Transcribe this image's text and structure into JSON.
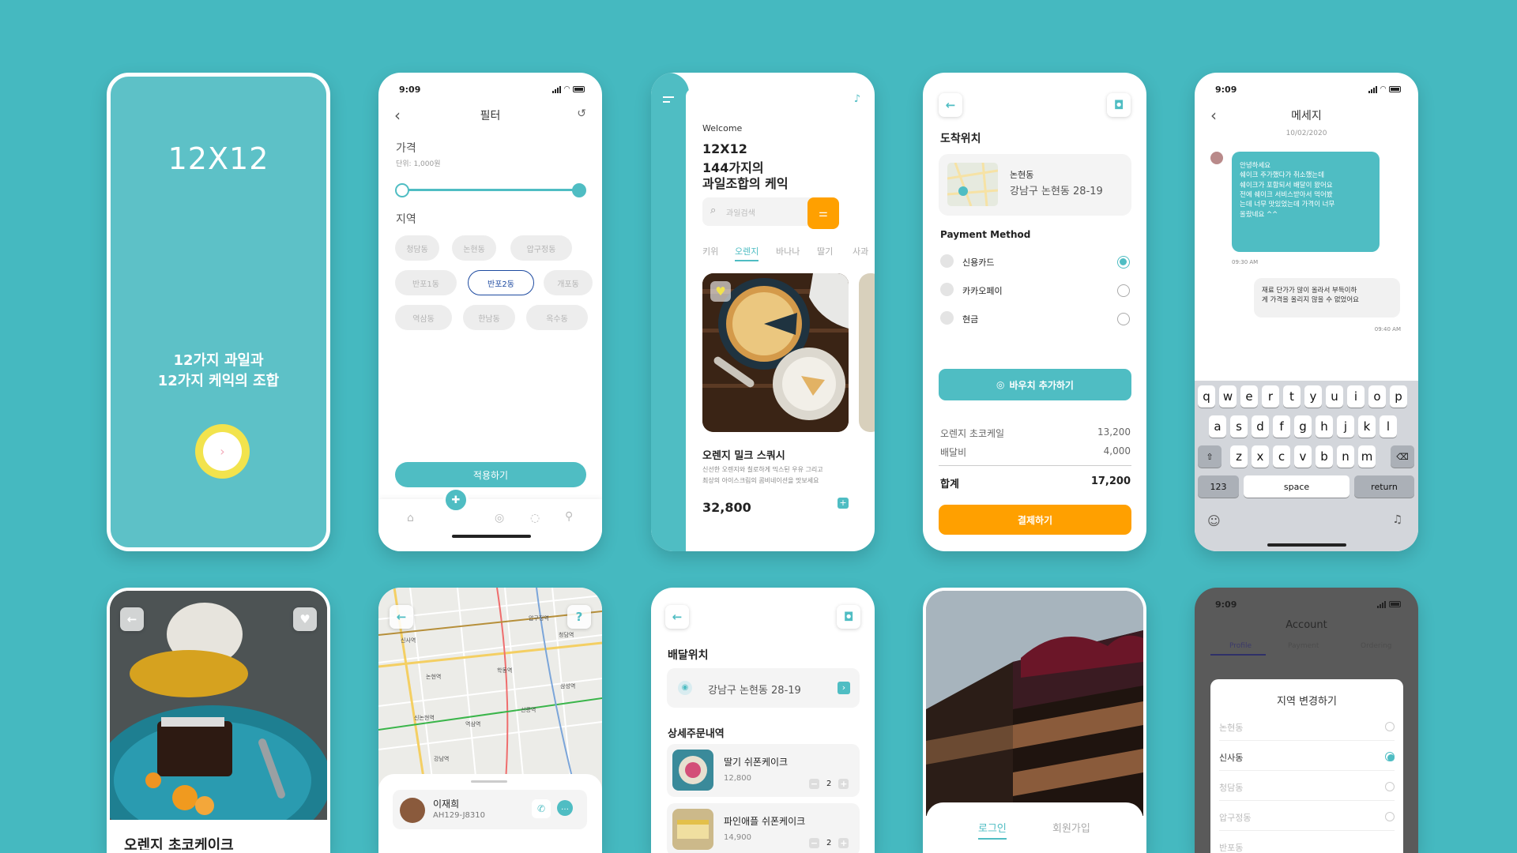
{
  "colors": {
    "background": "#45b9c0",
    "teal": "#4fbdc3",
    "orange": "#ffa000",
    "yellow": "#f2e34d"
  },
  "splash": {
    "logo": "12X12",
    "tagline_line1": "12가지 과일과",
    "tagline_line2": "12가지 케익의 조합",
    "next_icon": "chevron-right-icon"
  },
  "filter": {
    "time": "9:09",
    "title": "필터",
    "price_label": "가격",
    "price_unit": "단위: 1,000원",
    "region_label": "지역",
    "regions": [
      "청담동",
      "논현동",
      "압구정동",
      "반포1동",
      "반포2동",
      "개포동",
      "역삼동",
      "한남동",
      "옥수동"
    ],
    "selected_region": "반포2동",
    "apply_button": "적용하기"
  },
  "home": {
    "welcome": "Welcome",
    "headline_1": "12X12",
    "headline_2": "144가지의",
    "headline_3": "과일조합의 케익",
    "search_placeholder": "과일검색",
    "tabs": [
      "키위",
      "오렌지",
      "바나나",
      "딸기",
      "사과"
    ],
    "active_tab": "오렌지",
    "product_name": "오렌지 밀크 스쿼시",
    "product_desc_1": "신선한 오렌지와 칠로하게 믹스된 우유 그리고",
    "product_desc_2": "최상의 아이스크림의 콤비네이션을 맛보세요",
    "price": "32,800"
  },
  "checkout": {
    "arrival_label": "도착위치",
    "location_name": "논현동",
    "location_address": "강남구 논현동 28-19",
    "payment_label": "Payment Method",
    "methods": [
      "신용카드",
      "카카오페이",
      "현금"
    ],
    "selected_method": "신용카드",
    "voucher_button": "바우치 추가하기",
    "items": [
      {
        "name": "오렌지 초코케일",
        "price": "13,200"
      },
      {
        "name": "배달비",
        "price": "4,000"
      }
    ],
    "total_label": "합계",
    "total": "17,200",
    "pay_button": "결제하기"
  },
  "message": {
    "time": "9:09",
    "title": "메세지",
    "date": "10/02/2020",
    "incoming": "안녕하세요\n쉐이크 주가했다가 취소했는데\n쉐이크가 포함되서 배달이 왔어요\n전에 쉐이크 서비스받아서 먹어봤\n는데 너무 맛있었는데 가격이 너무\n올랐네요 ^^",
    "incoming_time": "09:30 AM",
    "outgoing": "재료 단가가 많이 올라서 부득이하\n게 가격을 올리지 않을 수 없었어요",
    "outgoing_time": "09:40 AM",
    "keyboard": {
      "row1": [
        "q",
        "w",
        "e",
        "r",
        "t",
        "y",
        "u",
        "i",
        "o",
        "p"
      ],
      "row2": [
        "a",
        "s",
        "d",
        "f",
        "g",
        "h",
        "j",
        "k",
        "l"
      ],
      "row3": [
        "z",
        "x",
        "c",
        "v",
        "b",
        "n",
        "m"
      ],
      "numbers": "123",
      "space": "space",
      "return": "return"
    }
  },
  "detail": {
    "title": "오렌지 초코케이크"
  },
  "map": {
    "driver_name": "이재희",
    "driver_plate": "AH129-J8310",
    "places": [
      "신사역",
      "압구정역",
      "청담역",
      "논현역",
      "학동역",
      "신논현역",
      "강남역",
      "역삼역",
      "선릉역",
      "삼성역"
    ]
  },
  "order": {
    "delivery_label": "배달위치",
    "address": "강남구 논현동 28-19",
    "details_label": "상세주문내역",
    "items": [
      {
        "name": "딸기 쉬폰케이크",
        "price": "12,800",
        "qty": "2"
      },
      {
        "name": "파인애플 쉬폰케이크",
        "price": "14,900",
        "qty": "2"
      }
    ]
  },
  "login": {
    "tabs": [
      "로그인",
      "회원가입"
    ],
    "active": "로그인"
  },
  "account": {
    "time": "9:09",
    "title": "Account",
    "tabs": [
      "Profile",
      "Payment",
      "Ordering"
    ],
    "sheet_title": "지역 변경하기",
    "regions": [
      "논현동",
      "신사동",
      "청담동",
      "압구정동",
      "반포동"
    ],
    "selected": "신사동"
  }
}
